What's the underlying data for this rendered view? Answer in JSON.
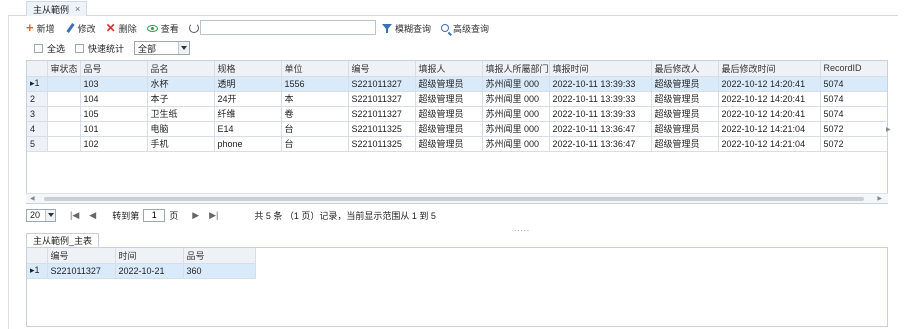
{
  "tab": {
    "label": "主从範例",
    "close": "×"
  },
  "toolbar": {
    "add": "新增",
    "edit": "修改",
    "delete": "删除",
    "view": "查看",
    "refresh": "刷新",
    "search_value": "",
    "fuzzy_query": "模糊查询",
    "advanced_query": "高级查询"
  },
  "options": {
    "select_all": "全选",
    "quick_stats": "快速统计",
    "filter_value": "全部"
  },
  "grid": {
    "columns": [
      "",
      "审状态",
      "品号",
      "品名",
      "规格",
      "单位",
      "编号",
      "填报人",
      "填报人所屬部门",
      "填报时间",
      "最后修改人",
      "最后修改时间",
      "RecordID"
    ],
    "rows": [
      [
        "1",
        "",
        "103",
        "水杯",
        "透明",
        "1556",
        "S221011327",
        "超级管理员",
        "苏州闻里   000",
        "2022-10-11 13:39:33",
        "超级管理员",
        "2022-10-12 14:20:41",
        "5074"
      ],
      [
        "2",
        "",
        "104",
        "本子",
        "24开",
        "本",
        "S221011327",
        "超级管理员",
        "苏州闻里   000",
        "2022-10-11 13:39:33",
        "超级管理员",
        "2022-10-12 14:20:41",
        "5074"
      ],
      [
        "3",
        "",
        "105",
        "卫生纸",
        "纤维",
        "卷",
        "S221011327",
        "超级管理员",
        "苏州闻里   000",
        "2022-10-11 13:39:33",
        "超级管理员",
        "2022-10-12 14:20:41",
        "5074"
      ],
      [
        "4",
        "",
        "101",
        "电脑",
        "E14",
        "台",
        "S221011325",
        "超级管理员",
        "苏州闻里   000",
        "2022-10-11 13:36:47",
        "超级管理员",
        "2022-10-12 14:21:04",
        "5072"
      ],
      [
        "5",
        "",
        "102",
        "手机",
        "phone",
        "台",
        "S221011325",
        "超级管理员",
        "苏州闻里   000",
        "2022-10-11 13:36:47",
        "超级管理员",
        "2022-10-12 14:21:04",
        "5072"
      ]
    ],
    "selected_row": 0
  },
  "pager": {
    "page_size": "20",
    "goto_prefix": "转到第",
    "page": "1",
    "page_suffix": "页",
    "summary": "共 5 条 （1 页）记录，当前显示范围从 1 到 5",
    "dots": "....."
  },
  "sub": {
    "tab_label": "主从範例_主表",
    "columns": [
      "",
      "编号",
      "时间",
      "品号"
    ],
    "rows": [
      [
        "1",
        "S221011327",
        "2022-10-21",
        "360"
      ]
    ]
  },
  "colors": {
    "selected_row": "#d9ebfb",
    "header_bg": "#eef2f7",
    "add_icon": "#e06b1a",
    "delete_icon": "#dd3333"
  },
  "icons": [
    "plus-icon",
    "pencil-icon",
    "x-icon",
    "eye-icon",
    "refresh-icon",
    "funnel-icon",
    "magnifier-icon"
  ]
}
